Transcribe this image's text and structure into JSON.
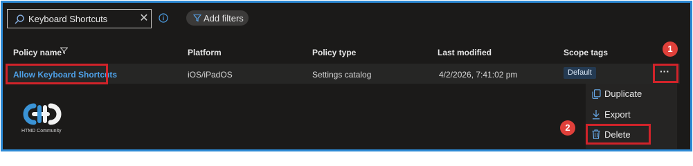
{
  "search": {
    "value": "Keyboard Shortcuts",
    "clear_icon": "close-icon",
    "icon": "search-icon"
  },
  "toolbar": {
    "add_filters_label": "Add filters",
    "info_icon": "info-icon"
  },
  "table": {
    "headers": {
      "policy_name": "Policy name",
      "platform": "Platform",
      "policy_type": "Policy type",
      "last_modified": "Last modified",
      "scope_tags": "Scope tags"
    },
    "rows": [
      {
        "policy_name": "Allow Keyboard Shortcuts",
        "platform": "iOS/iPadOS",
        "policy_type": "Settings catalog",
        "last_modified": "4/2/2026, 7:41:02 pm",
        "scope_tag": "Default",
        "more_label": "···"
      }
    ]
  },
  "context_menu": {
    "items": [
      {
        "label": "Duplicate",
        "icon": "duplicate-icon"
      },
      {
        "label": "Export",
        "icon": "download-icon"
      },
      {
        "label": "Delete",
        "icon": "trash-icon"
      }
    ]
  },
  "annotations": {
    "step1": "1",
    "step2": "2"
  },
  "logo": {
    "text": "HTMD Community"
  },
  "colors": {
    "background": "#1b1a19",
    "frame_border": "#2d8ad6",
    "link": "#4ea1e8",
    "highlight_border": "#d1232a",
    "step_badge": "#e0403a"
  }
}
